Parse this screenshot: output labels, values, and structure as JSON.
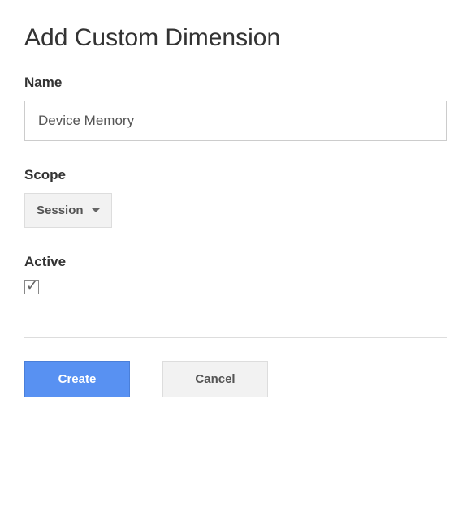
{
  "title": "Add Custom Dimension",
  "fields": {
    "name": {
      "label": "Name",
      "value": "Device Memory"
    },
    "scope": {
      "label": "Scope",
      "selected": "Session"
    },
    "active": {
      "label": "Active",
      "checked": true
    }
  },
  "buttons": {
    "create": "Create",
    "cancel": "Cancel"
  }
}
